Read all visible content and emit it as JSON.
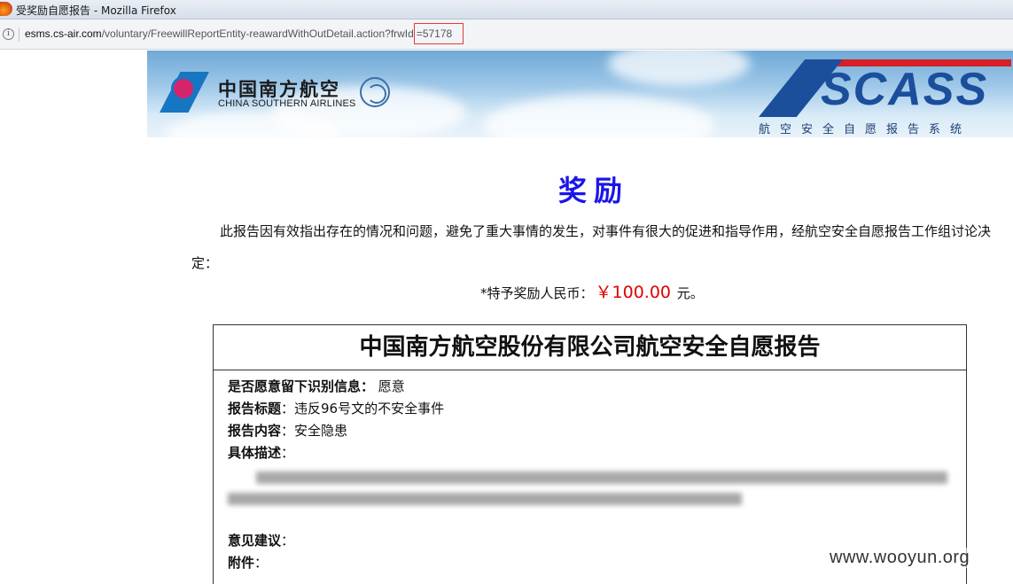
{
  "window": {
    "title": "受奖励自愿报告 - Mozilla Firefox"
  },
  "address_bar": {
    "url_host": "esms.cs-air.com",
    "url_path": "/voluntary/FreewillReportEntity-reawardWithOutDetail.action?frwId",
    "url_highlight": "=57178"
  },
  "banner": {
    "airline_cn": "中国南方航空",
    "airline_en": "CHINA SOUTHERN AIRLINES",
    "system_logo": "SCASS",
    "system_name": "航空安全自愿报告系统"
  },
  "award": {
    "title": "奖励",
    "paragraph": "此报告因有效指出存在的情况和问题，避免了重大事情的发生，对事件有很大的促进和指导作用，经航空安全自愿报告工作组讨论决定：",
    "amount_prefix": "*特予奖励人民币：",
    "amount": "￥100.00",
    "amount_suffix": " 元。"
  },
  "report": {
    "heading": "中国南方航空股份有限公司航空安全自愿报告",
    "fields": {
      "identity_label": "是否愿意留下识别信息：",
      "identity_value": " 愿意",
      "title_label": "报告标题",
      "title_value": "：违反96号文的不安全事件",
      "content_label": "报告内容",
      "content_value": "：安全隐患",
      "description_label": "具体描述",
      "description_value": "：",
      "suggestion_label": "意见建议",
      "suggestion_value": "：",
      "attachment_label": "附件",
      "attachment_value": "："
    }
  },
  "watermark": "www.wooyun.org",
  "colors": {
    "award_title": "#1a16e8",
    "amount": "#e00000",
    "url_highlight_border": "#e33b3b"
  }
}
